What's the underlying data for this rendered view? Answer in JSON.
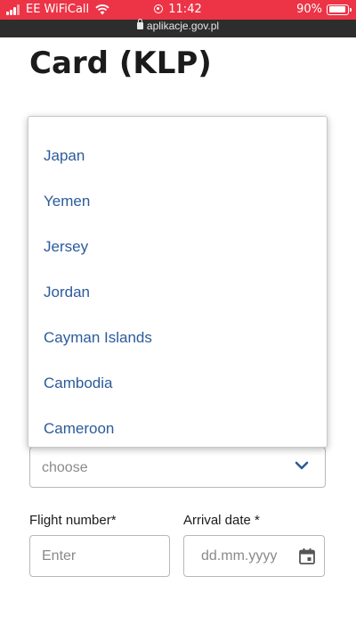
{
  "status_bar": {
    "carrier": "EE WiFiCall",
    "time": "11:42",
    "battery": "90%",
    "battery_level": 0.9
  },
  "browser": {
    "url": "aplikacje.gov.pl"
  },
  "page": {
    "title": "Card (KLP)"
  },
  "country_select": {
    "value": "choose",
    "options": [
      "Japan",
      "Yemen",
      "Jersey",
      "Jordan",
      "Cayman Islands",
      "Cambodia",
      "Cameroon"
    ]
  },
  "flight_number": {
    "label": "Flight number*",
    "placeholder": "Enter"
  },
  "arrival_date": {
    "label": "Arrival date *",
    "placeholder": "dd.mm.yyyy"
  },
  "colors": {
    "status_bar": "#ec3446",
    "url_bar": "#2d2d2d",
    "link_blue": "#2b5b9a"
  }
}
